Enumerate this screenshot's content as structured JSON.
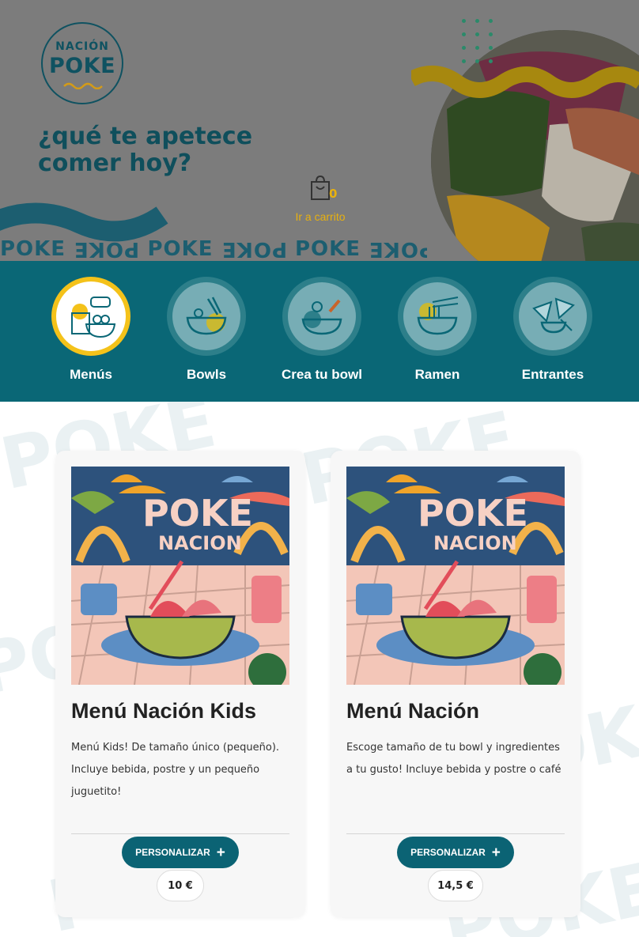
{
  "header": {
    "logo_line1": "NACIÓN",
    "logo_line2": "POKE",
    "headline": "¿qué te apetece comer hoy?",
    "cart": {
      "count": "0",
      "label": "Ir a carrito"
    },
    "pattern_word": "POKE"
  },
  "categories": [
    {
      "label": "Menús",
      "icon": "menu-combo-icon",
      "active": true
    },
    {
      "label": "Bowls",
      "icon": "bowl-icon",
      "active": false
    },
    {
      "label": "Crea tu bowl",
      "icon": "create-bowl-icon",
      "active": false
    },
    {
      "label": "Ramen",
      "icon": "ramen-icon",
      "active": false
    },
    {
      "label": "Entrantes",
      "icon": "starters-icon",
      "active": false
    }
  ],
  "products": [
    {
      "title": "Menú Nación Kids",
      "description": "Menú Kids! De tamaño único (pequeño). Incluye bebida, postre y un pequeño juguetito!",
      "button_label": "PERSONALIZAR",
      "price": "10 €",
      "image_text_1": "POKE",
      "image_text_2": "NACION"
    },
    {
      "title": "Menú Nación",
      "description": "Escoge tamaño de tu bowl y ingredientes a tu gusto! Incluye bebida y postre o café",
      "button_label": "PERSONALIZAR",
      "price": "14,5 €",
      "image_text_1": "POKE",
      "image_text_2": "NACION"
    }
  ],
  "colors": {
    "brand_teal": "#0a6776",
    "button_teal": "#0b6374",
    "accent_yellow": "#f4c21a",
    "cart_yellow": "#e8b10f"
  }
}
